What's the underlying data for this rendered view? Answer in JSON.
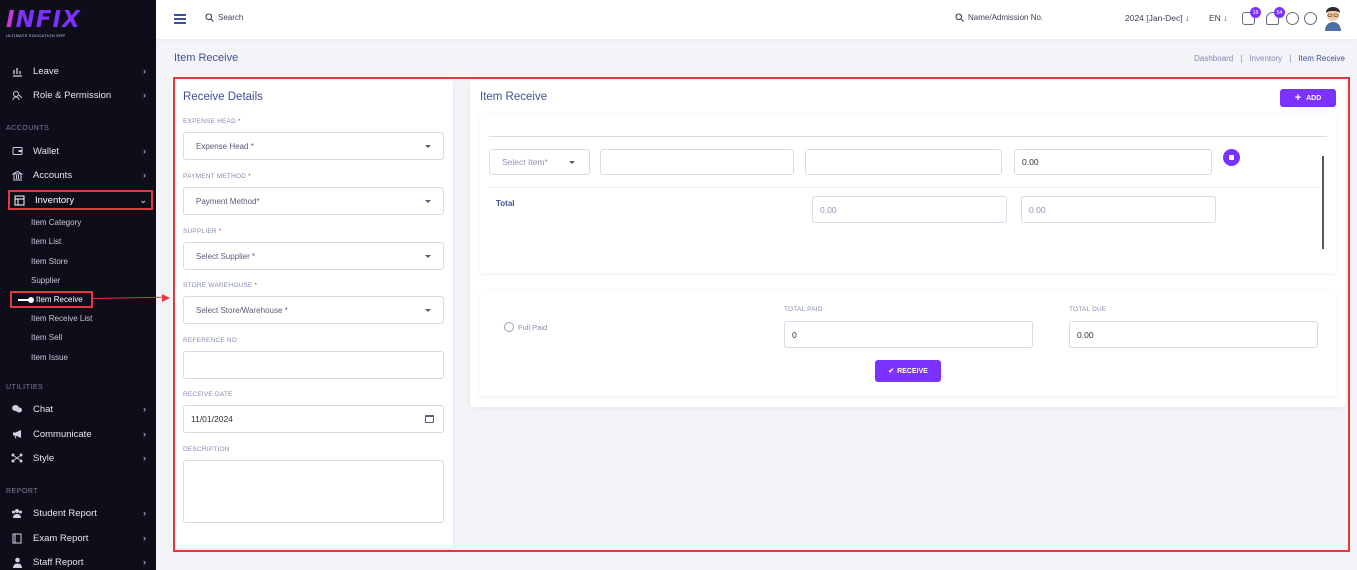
{
  "brand": {
    "logo_main_a": "I",
    "logo_main_b": "NFIX",
    "logo_sub": "ULTIMATE EDUCATION ERP"
  },
  "sidebar": {
    "items_top": [
      {
        "label": "Leave",
        "icon": "leave-icon"
      },
      {
        "label": "Role & Permission",
        "icon": "role-icon"
      }
    ],
    "section_accounts": "ACCOUNTS",
    "items_accounts": [
      {
        "label": "Wallet",
        "icon": "wallet-icon"
      },
      {
        "label": "Accounts",
        "icon": "bank-icon"
      },
      {
        "label": "Inventory",
        "icon": "inventory-icon"
      }
    ],
    "inventory_sub": [
      "Item Category",
      "Item List",
      "Item Store",
      "Supplier",
      "Item Receive",
      "Item Receive List",
      "Item Sell",
      "Item Issue"
    ],
    "section_utilities": "UTILITIES",
    "items_utilities": [
      {
        "label": "Chat",
        "icon": "chat-icon"
      },
      {
        "label": "Communicate",
        "icon": "megaphone-icon"
      },
      {
        "label": "Style",
        "icon": "style-icon"
      }
    ],
    "section_report": "REPORT",
    "items_report": [
      {
        "label": "Student Report",
        "icon": "users-icon"
      },
      {
        "label": "Exam Report",
        "icon": "book-icon"
      },
      {
        "label": "Staff Report",
        "icon": "user-icon"
      }
    ]
  },
  "header": {
    "search_label": "Search",
    "search2_label": "Name/Admission No.",
    "session": "2024 [Jan-Dec]",
    "lang": "EN",
    "chat_badge": "16",
    "notif_badge": "54"
  },
  "page": {
    "title": "Item Receive",
    "breadcrumb": [
      "Dashboard",
      "Inventory",
      "Item Receive"
    ]
  },
  "receive_details": {
    "title": "Receive Details",
    "expense_head_label": "EXPENSE HEAD",
    "expense_head_value": "Expense Head *",
    "payment_method_label": "PAYMENT METHOD",
    "payment_method_value": "Payment Method*",
    "supplier_label": "SUPPLIER",
    "supplier_value": "Select Supplier *",
    "store_label": "STORE WAREHOUSE",
    "store_value": "Select Store/Warehouse *",
    "reference_label": "REFERENCE NO",
    "reference_value": "",
    "date_label": "RECEIVE DATE",
    "date_value": "11/01/2024",
    "description_label": "DESCRIPTION",
    "required_mark": "*"
  },
  "item_receive": {
    "title": "Item Receive",
    "add_label": "ADD",
    "row": {
      "item_placeholder": "Select Item*",
      "qty": "",
      "price": "",
      "amount": "0.00"
    },
    "total_label": "Total",
    "total_qty": "0.00",
    "total_amount": "0.00",
    "full_paid_label": "Full Paid",
    "total_paid_label": "TOTAL PAID",
    "total_paid_value": "0",
    "total_due_label": "TOTAL DUE",
    "total_due_value": "0.00",
    "receive_label": "RECEIVE"
  },
  "colors": {
    "primary": "#7c32ff",
    "sidebar_bg": "#0e0e1a",
    "annotation": "#e0393e",
    "text": "#415094"
  }
}
